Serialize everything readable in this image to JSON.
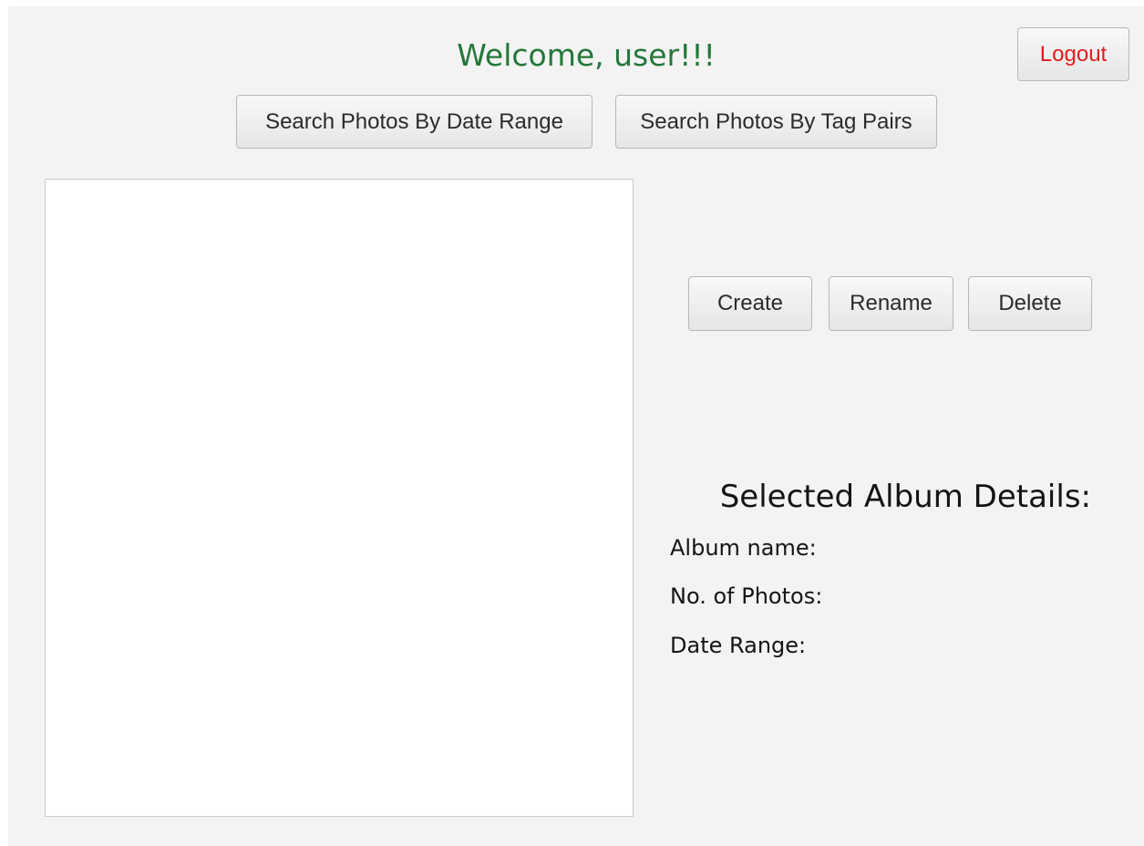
{
  "header": {
    "welcome_text": "Welcome, user!!!",
    "logout_label": "Logout"
  },
  "search": {
    "date_range_label": "Search Photos By Date Range",
    "tag_pairs_label": "Search Photos By Tag Pairs"
  },
  "album_actions": {
    "create_label": "Create",
    "rename_label": "Rename",
    "delete_label": "Delete"
  },
  "album_list": {
    "items": []
  },
  "details": {
    "title": "Selected Album Details:",
    "album_name_label": "Album name:",
    "photo_count_label": "No. of Photos:",
    "date_range_label": "Date Range:"
  },
  "colors": {
    "welcome": "#24773a",
    "logout": "#e51b1b",
    "background": "#f3f3f3"
  }
}
